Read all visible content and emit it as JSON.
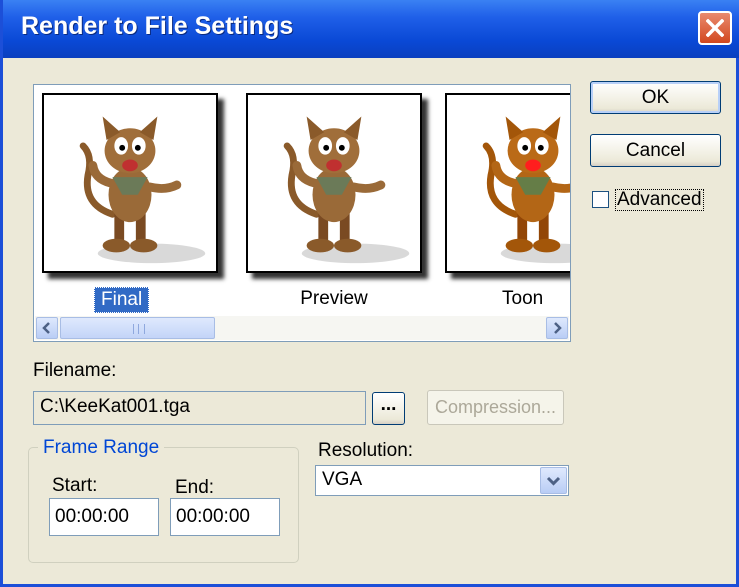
{
  "window": {
    "title": "Render to File Settings"
  },
  "gallery": {
    "items": [
      {
        "label": "Final",
        "selected": true
      },
      {
        "label": "Preview",
        "selected": false
      },
      {
        "label": "Toon",
        "selected": false
      }
    ]
  },
  "buttons": {
    "ok": "OK",
    "cancel": "Cancel",
    "browse": "...",
    "compression": "Compression..."
  },
  "advanced": {
    "label": "Advanced",
    "checked": false
  },
  "filename": {
    "label": "Filename:",
    "value": "C:\\KeeKat001.tga"
  },
  "frame_range": {
    "title": "Frame Range",
    "start_label": "Start:",
    "start_value": "00:00:00",
    "end_label": "End:",
    "end_value": "00:00:00"
  },
  "resolution": {
    "label": "Resolution:",
    "value": "VGA"
  },
  "icons": [
    "close-icon",
    "scroll-left-icon",
    "scroll-right-icon",
    "dropdown-arrow-icon"
  ],
  "colors": {
    "titlebar": "#0a49d6",
    "selection": "#316ac5",
    "dialog_bg": "#ece9d8",
    "close": "#d2481f"
  }
}
